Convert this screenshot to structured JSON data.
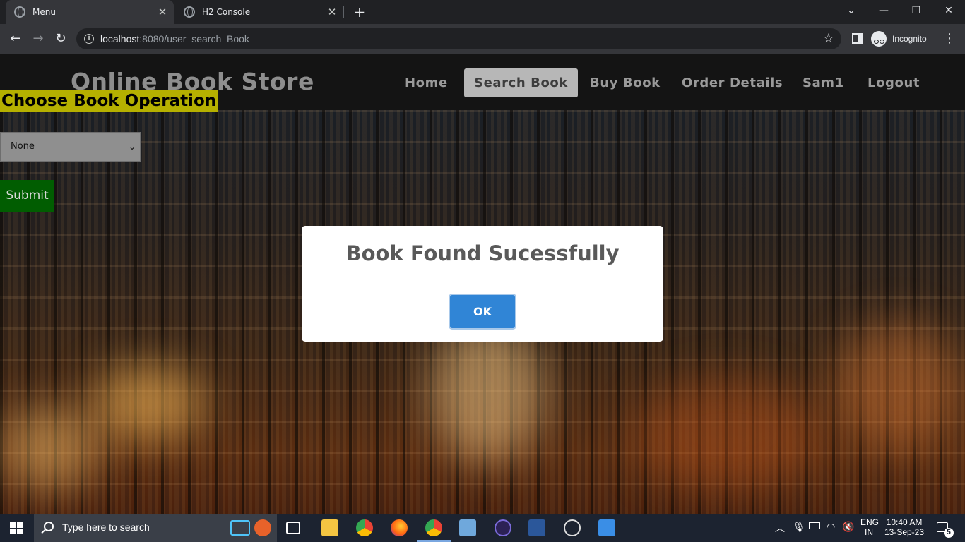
{
  "browser": {
    "tabs": [
      {
        "label": "Menu",
        "active": true
      },
      {
        "label": "H2 Console",
        "active": false
      }
    ],
    "url_host": "localhost",
    "url_rest": ":8080/user_search_Book",
    "mode_label": "Incognito"
  },
  "site": {
    "title": "Online Book Store",
    "nav": [
      {
        "label": "Home",
        "active": false
      },
      {
        "label": "Search Book",
        "active": true
      },
      {
        "label": "Buy Book",
        "active": false
      },
      {
        "label": "Order Details",
        "active": false
      },
      {
        "label": "Sam1",
        "active": false
      },
      {
        "label": "Logout",
        "active": false
      }
    ]
  },
  "operation": {
    "heading": "Choose Book Operation",
    "selected": "None",
    "submit_label": "Submit"
  },
  "dialog": {
    "title": "Book Found Sucessfully",
    "ok_label": "OK"
  },
  "taskbar": {
    "search_placeholder": "Type here to search",
    "language": "ENG",
    "region": "IN",
    "time": "10:40 AM",
    "date": "13-Sep-23",
    "notification_count": "5"
  },
  "colors": {
    "heading_bg": "#b5b000",
    "submit_bg": "#015d01",
    "ok_bg": "#3085d6",
    "nav_active_bg": "#b7b7b7"
  }
}
